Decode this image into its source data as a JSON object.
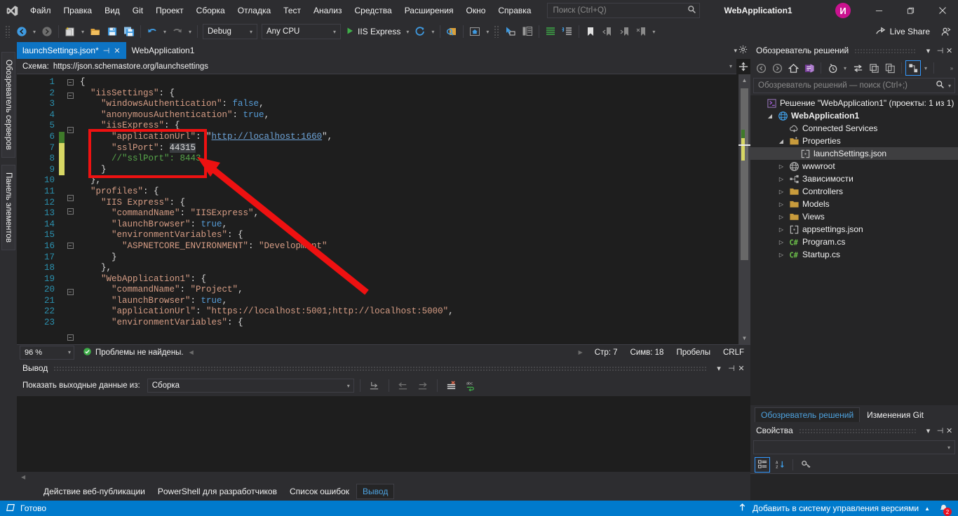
{
  "window": {
    "title": "WebApplication1",
    "account_initial": "И",
    "minimize": "—",
    "restore": "❐",
    "close": "✕"
  },
  "menu": {
    "items": [
      {
        "label": "Файл",
        "name": "menu-file"
      },
      {
        "label": "Правка",
        "name": "menu-edit"
      },
      {
        "label": "Вид",
        "name": "menu-view"
      },
      {
        "label": "Git",
        "name": "menu-git"
      },
      {
        "label": "Проект",
        "name": "menu-project"
      },
      {
        "label": "Сборка",
        "name": "menu-build"
      },
      {
        "label": "Отладка",
        "name": "menu-debug"
      },
      {
        "label": "Тест",
        "name": "menu-test"
      },
      {
        "label": "Анализ",
        "name": "menu-analyze"
      },
      {
        "label": "Средства",
        "name": "menu-tools"
      },
      {
        "label": "Расширения",
        "name": "menu-extensions"
      },
      {
        "label": "Окно",
        "name": "menu-window"
      },
      {
        "label": "Справка",
        "name": "menu-help"
      }
    ]
  },
  "search": {
    "placeholder": "Поиск (Ctrl+Q)"
  },
  "toolbar": {
    "configuration": "Debug",
    "platform": "Any CPU",
    "run_target": "IIS Express",
    "live_share": "Live Share"
  },
  "left_dock": {
    "tabs": [
      "Обозреватель серверов",
      "Панель элементов"
    ]
  },
  "editor": {
    "tabs": [
      {
        "label": "launchSettings.json*",
        "active": true
      },
      {
        "label": "WebApplication1",
        "active": false
      }
    ],
    "schema_label": "Схема:",
    "schema_value": "https://json.schemastore.org/launchsettings",
    "zoom": "96 %",
    "problems": "Проблемы не найдены.",
    "line_label": "Стр: 7",
    "col_label": "Симв: 18",
    "spaces": "Пробелы",
    "eol": "CRLF",
    "lines": [
      {
        "n": 1,
        "indent": 0,
        "fold": "minus",
        "change": "none",
        "tokens": [
          {
            "t": "{",
            "c": "k-pun"
          }
        ]
      },
      {
        "n": 2,
        "indent": 1,
        "fold": "minus",
        "change": "none",
        "tokens": [
          {
            "t": "\"iisSettings\"",
            "c": "k-key"
          },
          {
            "t": ": {",
            "c": "k-pun"
          }
        ]
      },
      {
        "n": 3,
        "indent": 2,
        "fold": "none",
        "change": "none",
        "tokens": [
          {
            "t": "\"windowsAuthentication\"",
            "c": "k-key"
          },
          {
            "t": ": ",
            "c": "k-pun"
          },
          {
            "t": "false",
            "c": "k-lit"
          },
          {
            "t": ",",
            "c": "k-pun"
          }
        ]
      },
      {
        "n": 4,
        "indent": 2,
        "fold": "none",
        "change": "none",
        "tokens": [
          {
            "t": "\"anonymousAuthentication\"",
            "c": "k-key"
          },
          {
            "t": ": ",
            "c": "k-pun"
          },
          {
            "t": "true",
            "c": "k-lit"
          },
          {
            "t": ",",
            "c": "k-pun"
          }
        ]
      },
      {
        "n": 5,
        "indent": 2,
        "fold": "minus",
        "change": "none",
        "tokens": [
          {
            "t": "\"iisExpress\"",
            "c": "k-key"
          },
          {
            "t": ": {",
            "c": "k-pun"
          }
        ]
      },
      {
        "n": 6,
        "indent": 3,
        "fold": "none",
        "change": "green",
        "tokens": [
          {
            "t": "\"applicationUrl\"",
            "c": "k-key"
          },
          {
            "t": ": \"",
            "c": "k-pun"
          },
          {
            "t": "http://localhost:1660",
            "c": "k-lnk"
          },
          {
            "t": "\",",
            "c": "k-pun"
          }
        ]
      },
      {
        "n": 7,
        "indent": 3,
        "fold": "none",
        "change": "yellow",
        "tokens": [
          {
            "t": "\"sslPort\"",
            "c": "k-key"
          },
          {
            "t": ": ",
            "c": "k-pun"
          },
          {
            "t": "44315",
            "c": "k-num sel"
          }
        ]
      },
      {
        "n": 8,
        "indent": 3,
        "fold": "none",
        "change": "yellow",
        "tokens": [
          {
            "t": "//\"sslPort\": 8443",
            "c": "k-cmt"
          }
        ]
      },
      {
        "n": 9,
        "indent": 2,
        "fold": "none",
        "change": "yellow",
        "tokens": [
          {
            "t": "}",
            "c": "k-pun"
          }
        ]
      },
      {
        "n": 10,
        "indent": 1,
        "fold": "none",
        "change": "none",
        "tokens": [
          {
            "t": "},",
            "c": "k-pun"
          }
        ]
      },
      {
        "n": 11,
        "indent": 1,
        "fold": "minus",
        "change": "none",
        "tokens": [
          {
            "t": "\"profiles\"",
            "c": "k-key"
          },
          {
            "t": ": {",
            "c": "k-pun"
          }
        ]
      },
      {
        "n": 12,
        "indent": 2,
        "fold": "minus",
        "change": "none",
        "tokens": [
          {
            "t": "\"IIS Express\"",
            "c": "k-key"
          },
          {
            "t": ": {",
            "c": "k-pun"
          }
        ]
      },
      {
        "n": 13,
        "indent": 3,
        "fold": "none",
        "change": "none",
        "tokens": [
          {
            "t": "\"commandName\"",
            "c": "k-key"
          },
          {
            "t": ": ",
            "c": "k-pun"
          },
          {
            "t": "\"IISExpress\"",
            "c": "k-str"
          },
          {
            "t": ",",
            "c": "k-pun"
          }
        ]
      },
      {
        "n": 14,
        "indent": 3,
        "fold": "none",
        "change": "none",
        "tokens": [
          {
            "t": "\"launchBrowser\"",
            "c": "k-key"
          },
          {
            "t": ": ",
            "c": "k-pun"
          },
          {
            "t": "true",
            "c": "k-lit"
          },
          {
            "t": ",",
            "c": "k-pun"
          }
        ]
      },
      {
        "n": 15,
        "indent": 3,
        "fold": "minus",
        "change": "none",
        "tokens": [
          {
            "t": "\"environmentVariables\"",
            "c": "k-key"
          },
          {
            "t": ": {",
            "c": "k-pun"
          }
        ]
      },
      {
        "n": 16,
        "indent": 4,
        "fold": "none",
        "change": "none",
        "tokens": [
          {
            "t": "\"ASPNETCORE_ENVIRONMENT\"",
            "c": "k-key"
          },
          {
            "t": ": ",
            "c": "k-pun"
          },
          {
            "t": "\"Development\"",
            "c": "k-str"
          }
        ]
      },
      {
        "n": 17,
        "indent": 3,
        "fold": "none",
        "change": "none",
        "tokens": [
          {
            "t": "}",
            "c": "k-pun"
          }
        ]
      },
      {
        "n": 18,
        "indent": 2,
        "fold": "none",
        "change": "none",
        "tokens": [
          {
            "t": "},",
            "c": "k-pun"
          }
        ]
      },
      {
        "n": 19,
        "indent": 2,
        "fold": "minus",
        "change": "none",
        "tokens": [
          {
            "t": "\"WebApplication1\"",
            "c": "k-key"
          },
          {
            "t": ": {",
            "c": "k-pun"
          }
        ]
      },
      {
        "n": 20,
        "indent": 3,
        "fold": "none",
        "change": "none",
        "tokens": [
          {
            "t": "\"commandName\"",
            "c": "k-key"
          },
          {
            "t": ": ",
            "c": "k-pun"
          },
          {
            "t": "\"Project\"",
            "c": "k-str"
          },
          {
            "t": ",",
            "c": "k-pun"
          }
        ]
      },
      {
        "n": 21,
        "indent": 3,
        "fold": "none",
        "change": "none",
        "tokens": [
          {
            "t": "\"launchBrowser\"",
            "c": "k-key"
          },
          {
            "t": ": ",
            "c": "k-pun"
          },
          {
            "t": "true",
            "c": "k-lit"
          },
          {
            "t": ",",
            "c": "k-pun"
          }
        ]
      },
      {
        "n": 22,
        "indent": 3,
        "fold": "none",
        "change": "none",
        "tokens": [
          {
            "t": "\"applicationUrl\"",
            "c": "k-key"
          },
          {
            "t": ": ",
            "c": "k-pun"
          },
          {
            "t": "\"https://localhost:5001;http://localhost:5000\"",
            "c": "k-str"
          },
          {
            "t": ",",
            "c": "k-pun"
          }
        ]
      },
      {
        "n": 23,
        "indent": 3,
        "fold": "minus",
        "change": "none",
        "tokens": [
          {
            "t": "\"environmentVariables\"",
            "c": "k-key"
          },
          {
            "t": ": {",
            "c": "k-pun"
          }
        ]
      }
    ]
  },
  "output_panel": {
    "title": "Вывод",
    "source_label": "Показать выходные данные из:",
    "source_value": "Сборка"
  },
  "bottom_tabs": [
    {
      "label": "Действие веб-публикации",
      "active": false
    },
    {
      "label": "PowerShell для разработчиков",
      "active": false
    },
    {
      "label": "Список ошибок",
      "active": false
    },
    {
      "label": "Вывод",
      "active": true
    }
  ],
  "solution_explorer": {
    "title": "Обозреватель решений",
    "search_placeholder": "Обозреватель решений — поиск (Ctrl+;)",
    "tree": [
      {
        "depth": 0,
        "twist": "none",
        "icon": "solution-icon",
        "label": "Решение \"WebApplication1\" (проекты: 1 из 1)",
        "bold": false,
        "selected": false
      },
      {
        "depth": 1,
        "twist": "expanded",
        "icon": "web-project-icon",
        "label": "WebApplication1",
        "bold": true,
        "selected": false
      },
      {
        "depth": 2,
        "twist": "none",
        "icon": "cloud-icon",
        "label": "Connected Services",
        "bold": false,
        "selected": false
      },
      {
        "depth": 2,
        "twist": "expanded",
        "icon": "folder-props-icon",
        "label": "Properties",
        "bold": false,
        "selected": false
      },
      {
        "depth": 3,
        "twist": "none",
        "icon": "json-icon",
        "label": "launchSettings.json",
        "bold": false,
        "selected": true
      },
      {
        "depth": 2,
        "twist": "collapsed",
        "icon": "globe-icon",
        "label": "wwwroot",
        "bold": false,
        "selected": false
      },
      {
        "depth": 2,
        "twist": "collapsed",
        "icon": "dependencies-icon",
        "label": "Зависимости",
        "bold": false,
        "selected": false
      },
      {
        "depth": 2,
        "twist": "collapsed",
        "icon": "folder-icon",
        "label": "Controllers",
        "bold": false,
        "selected": false
      },
      {
        "depth": 2,
        "twist": "collapsed",
        "icon": "folder-icon",
        "label": "Models",
        "bold": false,
        "selected": false
      },
      {
        "depth": 2,
        "twist": "collapsed",
        "icon": "folder-icon",
        "label": "Views",
        "bold": false,
        "selected": false
      },
      {
        "depth": 2,
        "twist": "collapsed",
        "icon": "json-icon",
        "label": "appsettings.json",
        "bold": false,
        "selected": false
      },
      {
        "depth": 2,
        "twist": "collapsed",
        "icon": "csharp-icon",
        "label": "Program.cs",
        "bold": false,
        "selected": false
      },
      {
        "depth": 2,
        "twist": "collapsed",
        "icon": "csharp-icon",
        "label": "Startup.cs",
        "bold": false,
        "selected": false
      }
    ]
  },
  "dock_tabs": [
    {
      "label": "Обозреватель решений",
      "active": true
    },
    {
      "label": "Изменения Git",
      "active": false
    }
  ],
  "properties_panel": {
    "title": "Свойства"
  },
  "statusbar": {
    "ready": "Готово",
    "source_control": "Добавить в систему управления версиями",
    "notification_count": "2"
  },
  "colors": {
    "accent_blue": "#007acc",
    "tab_active": "#0d74c4",
    "annotation_red": "#e81123",
    "chrome": "#2d2d30",
    "editor_bg": "#1e1e1e"
  }
}
